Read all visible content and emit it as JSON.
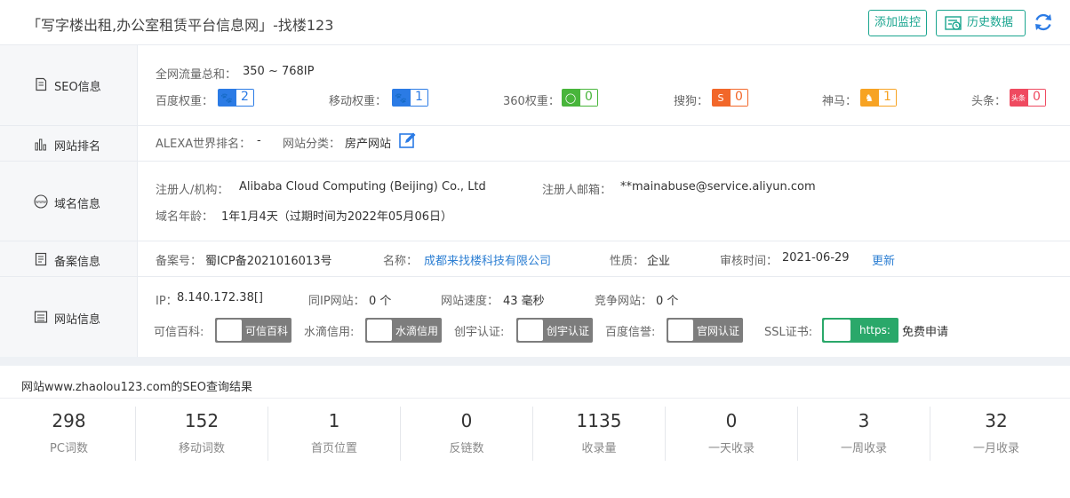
{
  "header": {
    "site_title": "「写字楼出租,办公室租赁平台信息网」-找楼123",
    "add_monitor": "添加监控",
    "history": "历史数据"
  },
  "seo": {
    "label": "SEO信息",
    "traffic_label": "全网流量总和：",
    "traffic_value": "350 ~ 768IP",
    "weights": [
      {
        "label": "百度权重：",
        "value": "2",
        "color": "#2b7be5"
      },
      {
        "label": "移动权重：",
        "value": "1",
        "color": "#2b7be5"
      },
      {
        "label": "360权重：",
        "value": "0",
        "color": "#48b53b"
      },
      {
        "label": "搜狗：",
        "value": "0",
        "color": "#f2672a"
      },
      {
        "label": "神马：",
        "value": "1",
        "color": "#f7a323"
      },
      {
        "label": "头条：",
        "value": "0",
        "color": "#ef4a60"
      }
    ],
    "toutiao_badge": "头条"
  },
  "rank": {
    "label": "网站排名",
    "alexa_label": "ALEXA世界排名：",
    "alexa_value": "-",
    "category_label": "网站分类：",
    "category_value": "房产网站"
  },
  "domain": {
    "label": "域名信息",
    "registrant_label": "注册人/机构：",
    "registrant_value": "Alibaba Cloud Computing (Beijing) Co., Ltd",
    "email_label": "注册人邮箱：",
    "email_value": "**mainabuse@service.aliyun.com",
    "age_label": "域名年龄：",
    "age_value": "1年1月4天（过期时间为2022年05月06日）"
  },
  "icp": {
    "label": "备案信息",
    "no_label": "备案号：",
    "no_value": "蜀ICP备2021016013号",
    "name_label": "名称：",
    "name_value": "成都来找楼科技有限公司",
    "type_label": "性质：",
    "type_value": "企业",
    "audit_label": "审核时间：",
    "audit_value": "2021-06-29",
    "update": "更新"
  },
  "site": {
    "label": "网站信息",
    "ip_label": "IP：",
    "ip_value": "8.140.172.38[]",
    "sameip_label": "同IP网站：",
    "sameip_value": "0 个",
    "speed_label": "网站速度：",
    "speed_value": "43 毫秒",
    "compete_label": "竞争网站：",
    "compete_value": "0 个",
    "credits": [
      {
        "label": "可信百科:",
        "badge": "可信百科",
        "color": "#7d7d7d"
      },
      {
        "label": "水滴信用:",
        "badge": "水滴信用",
        "color": "#7d7d7d"
      },
      {
        "label": "创宇认证:",
        "badge": "创宇认证",
        "color": "#7d7d7d"
      },
      {
        "label": "百度信誉:",
        "badge": "官网认证",
        "color": "#7d7d7d"
      }
    ],
    "ssl_label": "SSL证书:",
    "ssl_badge": "https:",
    "ssl_apply": "免费申请"
  },
  "result": {
    "title": "网站www.zhaolou123.com的SEO查询结果",
    "stats": [
      {
        "num": "298",
        "label": "PC词数"
      },
      {
        "num": "152",
        "label": "移动词数"
      },
      {
        "num": "1",
        "label": "首页位置"
      },
      {
        "num": "0",
        "label": "反链数"
      },
      {
        "num": "1135",
        "label": "收录量"
      },
      {
        "num": "0",
        "label": "一天收录"
      },
      {
        "num": "3",
        "label": "一周收录"
      },
      {
        "num": "32",
        "label": "一月收录"
      }
    ]
  }
}
